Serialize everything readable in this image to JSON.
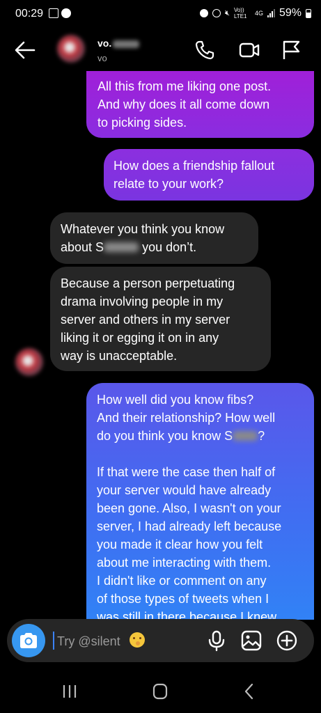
{
  "status_bar": {
    "time": "00:29",
    "network_label": "Vo)) LTE1",
    "net_type": "4G",
    "battery": "59%"
  },
  "header": {
    "contact_name": "vo.",
    "contact_username": "vo"
  },
  "messages": {
    "out1": "All this from me liking one post.\nAnd why does it all come down\nto picking sides.",
    "out2": "How does a friendship fallout\nrelate to your work?",
    "in1_before": "Whatever you think you know\nabout S",
    "in1_after": " you don’t.",
    "in2": "Because a person perpetuating\ndrama involving people in my\nserver and others in my server\nliking it or egging it on in any\nway is unacceptable.",
    "out3_before": "How well did you know fibs?\nAnd their relationship? How well\ndo you think you know S",
    "out3_after": "?\n\nIf that were the case then half of\nyour server would have already\nbeen gone. Also, I wasn't on your\nserver, I had already left because\nyou made it clear how you felt\nabout me interacting with them.\nI didn't like or comment on any\nof those types of tweets when I\nwas still in there because I knew"
  },
  "composer": {
    "placeholder": "Try @silent"
  },
  "colors": {
    "accent_blue": "#3797f0",
    "incoming_bubble": "#262626",
    "outgoing_purple": "#8a2de0"
  }
}
